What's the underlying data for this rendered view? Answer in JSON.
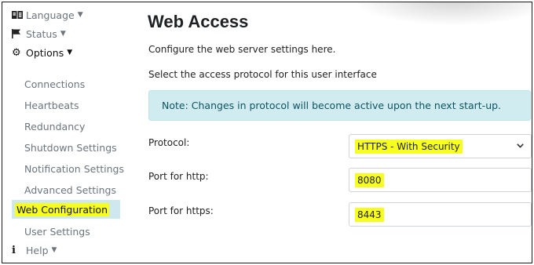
{
  "sidebar": {
    "language": {
      "label": "Language",
      "icon": "language-icon"
    },
    "status": {
      "label": "Status",
      "icon": "flag-icon"
    },
    "options": {
      "label": "Options",
      "icon": "gears-icon"
    },
    "items": [
      {
        "label": "Connections"
      },
      {
        "label": "Heartbeats"
      },
      {
        "label": "Redundancy"
      },
      {
        "label": "Shutdown Settings"
      },
      {
        "label": "Notification Settings"
      },
      {
        "label": "Advanced Settings"
      },
      {
        "label": "Web Configuration",
        "active": true
      },
      {
        "label": "User Settings"
      }
    ],
    "help": {
      "label": "Help",
      "icon": "info-icon"
    }
  },
  "main": {
    "title": "Web Access",
    "subtitle": "Configure the web server settings here.",
    "protocol_prompt": "Select the access protocol for this user interface",
    "note": "Note: Changes in protocol will become active upon the next start-up.",
    "protocol": {
      "label": "Protocol:",
      "value": "HTTPS - With Security"
    },
    "http_port": {
      "label": "Port for http:",
      "value": "8080"
    },
    "https_port": {
      "label": "Port for https:",
      "value": "8443"
    }
  },
  "colors": {
    "note_background": "#d1ecf1",
    "note_text": "#0c5460",
    "active_item_background": "#cfe7ef",
    "highlight": "#f7ff1f"
  }
}
